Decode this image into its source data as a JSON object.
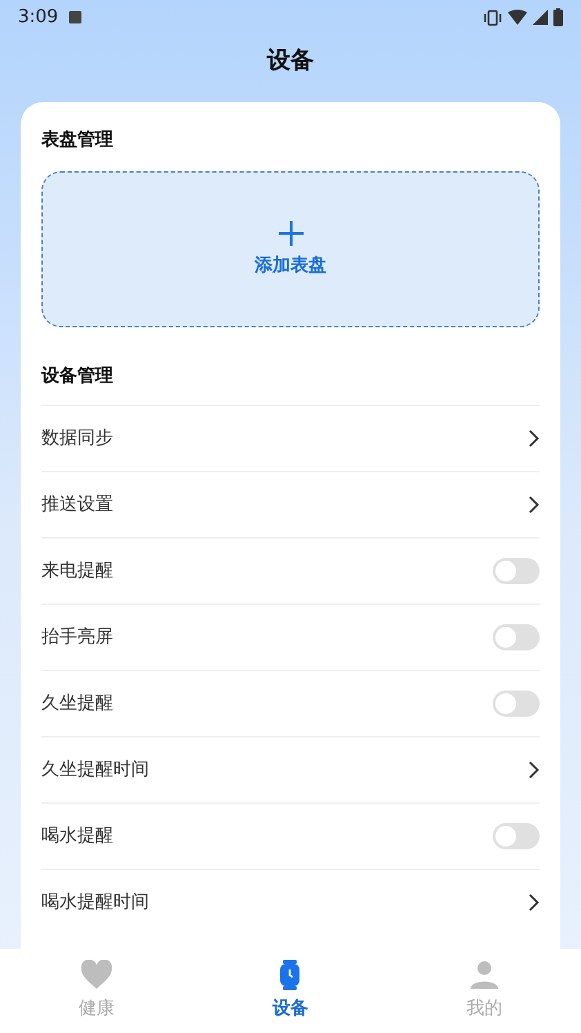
{
  "status_bar": {
    "time": "3:09"
  },
  "title": "设备",
  "watch_faces": {
    "heading": "表盘管理",
    "add_label": "添加表盘"
  },
  "device": {
    "heading": "设备管理",
    "items": [
      {
        "label": "数据同步",
        "kind": "link"
      },
      {
        "label": "推送设置",
        "kind": "link"
      },
      {
        "label": "来电提醒",
        "kind": "toggle",
        "on": false
      },
      {
        "label": "抬手亮屏",
        "kind": "toggle",
        "on": false
      },
      {
        "label": "久坐提醒",
        "kind": "toggle",
        "on": false
      },
      {
        "label": "久坐提醒时间",
        "kind": "link"
      },
      {
        "label": "喝水提醒",
        "kind": "toggle",
        "on": false
      },
      {
        "label": "喝水提醒时间",
        "kind": "link"
      }
    ]
  },
  "nav": [
    {
      "label": "健康",
      "kind": "heart",
      "selected": false
    },
    {
      "label": "设备",
      "kind": "watch",
      "selected": true
    },
    {
      "label": "我的",
      "kind": "person",
      "selected": false
    }
  ]
}
